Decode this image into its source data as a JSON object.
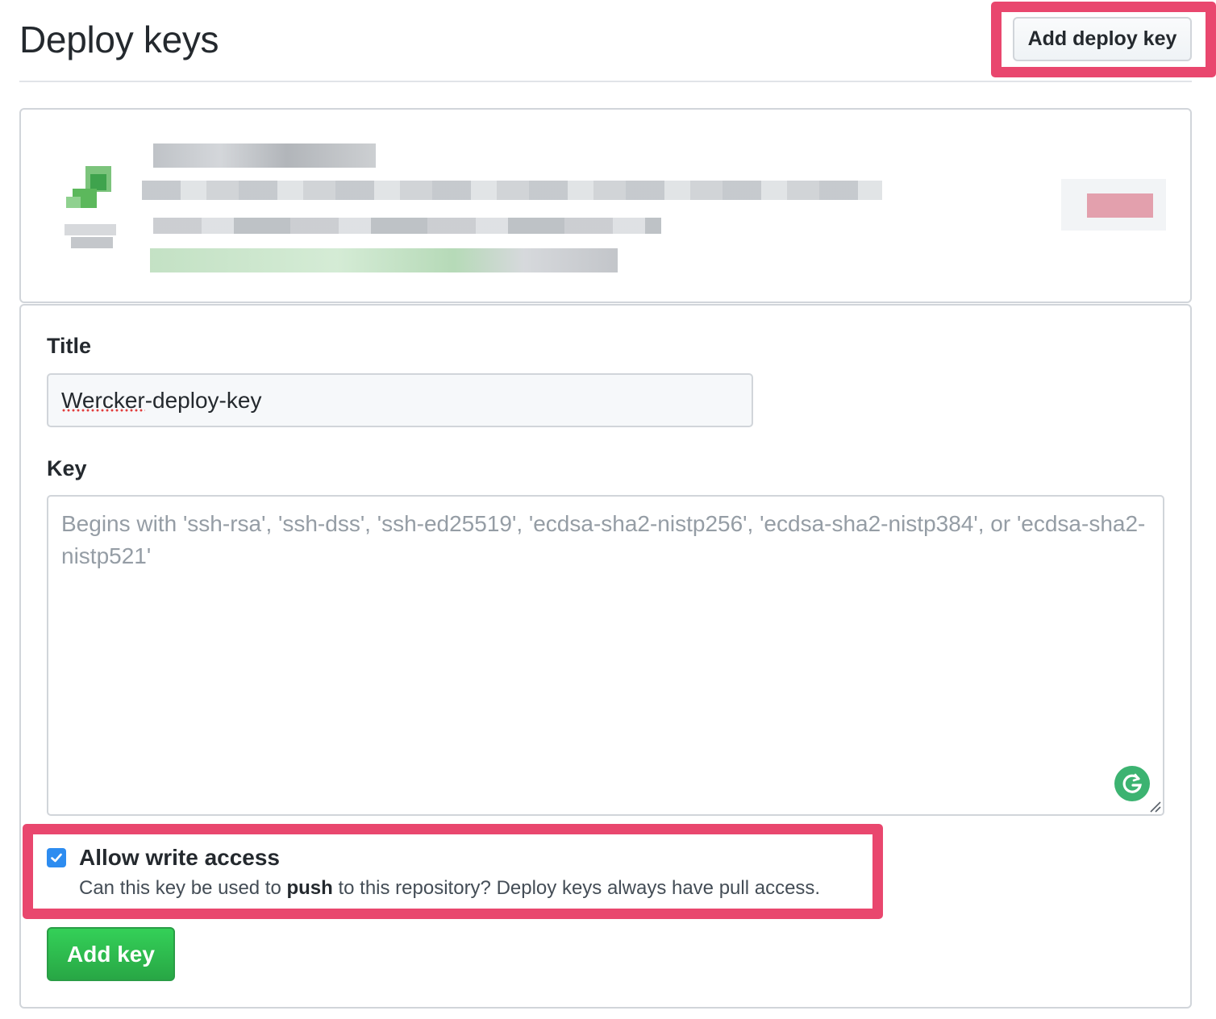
{
  "header": {
    "title": "Deploy keys",
    "add_deploy_key_label": "Add deploy key"
  },
  "form": {
    "title_label": "Title",
    "title_value": "Wercker-deploy-key",
    "key_label": "Key",
    "key_placeholder": "Begins with 'ssh-rsa', 'ssh-dss', 'ssh-ed25519', 'ecdsa-sha2-nistp256', 'ecdsa-sha2-nistp384', or 'ecdsa-sha2-nistp521'",
    "key_value": "",
    "allow_write": {
      "checked": true,
      "label": "Allow write access",
      "note_before": "Can this key be used to ",
      "note_bold": "push",
      "note_after": " to this repository? Deploy keys always have pull access."
    },
    "submit_label": "Add key"
  },
  "colors": {
    "highlight": "#e9476e",
    "primary_button": "#28a745",
    "checkbox": "#2d8cf0",
    "grammarly": "#3cb371"
  },
  "icons": [
    "key-icon",
    "grammarly-icon",
    "resize-handle-icon",
    "checkmark-icon"
  ]
}
